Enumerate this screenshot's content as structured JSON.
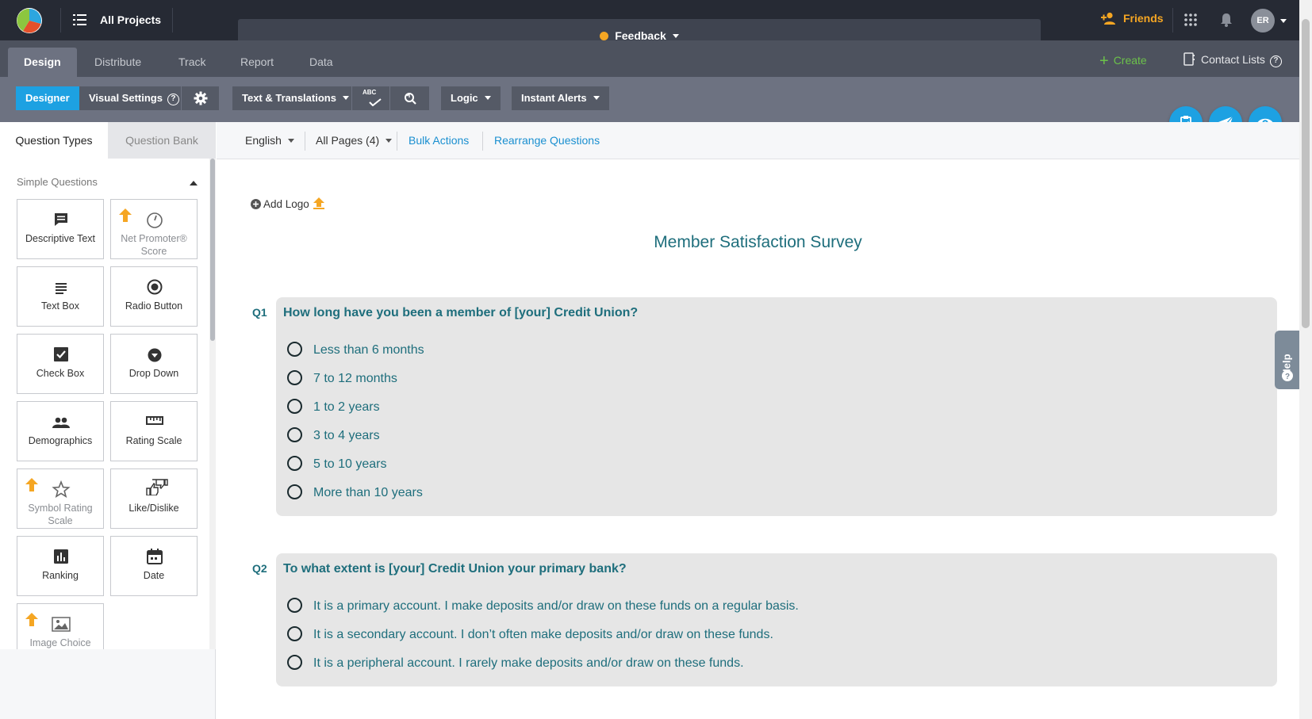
{
  "topbar": {
    "all_projects": "All Projects",
    "survey_name": "Feedback",
    "survey_status_color": "#f5a623",
    "friends": "Friends",
    "avatar_initials": "ER"
  },
  "nav": {
    "tabs": [
      "Design",
      "Distribute",
      "Track",
      "Report",
      "Data"
    ],
    "active_tab": "Design",
    "create": "Create",
    "contact_lists": "Contact Lists"
  },
  "toolbar": {
    "designer": "Designer",
    "visual_settings": "Visual Settings",
    "text_translations": "Text & Translations",
    "spellcheck_label": "ABC",
    "logic": "Logic",
    "instant_alerts": "Instant Alerts"
  },
  "left_panel": {
    "tabs": [
      "Question Types",
      "Question Bank"
    ],
    "section": "Simple Questions",
    "cards": [
      {
        "label": "Descriptive Text",
        "icon": "comment-icon",
        "pro": false
      },
      {
        "label": "Net Promoter® Score",
        "icon": "gauge-icon",
        "pro": true
      },
      {
        "label": "Text Box",
        "icon": "lines-icon",
        "pro": false
      },
      {
        "label": "Radio Button",
        "icon": "radio-icon",
        "pro": false
      },
      {
        "label": "Check Box",
        "icon": "checkbox-icon",
        "pro": false
      },
      {
        "label": "Drop Down",
        "icon": "dropdown-icon",
        "pro": false
      },
      {
        "label": "Demographics",
        "icon": "people-icon",
        "pro": false
      },
      {
        "label": "Rating Scale",
        "icon": "ruler-icon",
        "pro": false
      },
      {
        "label": "Symbol Rating Scale",
        "icon": "star-icon",
        "pro": true
      },
      {
        "label": "Like/Dislike",
        "icon": "thumbs-icon",
        "pro": false
      },
      {
        "label": "Ranking",
        "icon": "bar-chart-icon",
        "pro": false
      },
      {
        "label": "Date",
        "icon": "calendar-icon",
        "pro": false
      },
      {
        "label": "Image Choice",
        "icon": "image-icon",
        "pro": true
      }
    ]
  },
  "filterbar": {
    "language": "English",
    "pages": "All Pages (4)",
    "bulk_actions": "Bulk Actions",
    "rearrange": "Rearrange Questions"
  },
  "survey": {
    "add_logo": "Add Logo",
    "title": "Member Satisfaction Survey",
    "questions": [
      {
        "number": "Q1",
        "text": "How long have you been a member of [your] Credit Union?",
        "options": [
          "Less than 6 months",
          "7 to 12 months",
          "1 to 2 years",
          "3 to 4 years",
          "5 to 10 years",
          "More than 10 years"
        ]
      },
      {
        "number": "Q2",
        "text": "To what extent is [your] Credit Union your primary bank?",
        "options": [
          "It is a primary account. I make deposits and/or draw on these funds on a regular basis.",
          "It is a secondary account. I don’t often make deposits and/or draw on these funds.",
          "It is a peripheral account. I rarely make deposits and/or draw on these funds."
        ]
      }
    ]
  },
  "help": "Help",
  "colors": {
    "accent_blue": "#1da1e2",
    "survey_teal": "#1e6e7c",
    "create_green": "#6cc24a",
    "pro_orange": "#f5a623"
  }
}
